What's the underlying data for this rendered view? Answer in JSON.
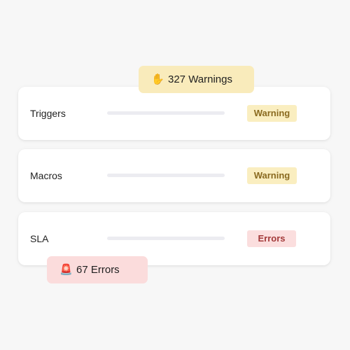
{
  "colors": {
    "warning_bg": "#faeec0",
    "warning_text": "#8a6a1f",
    "error_bg": "#fbdede",
    "error_text": "#a33a3a",
    "warning_pill_bg": "#f9ebbb",
    "error_pill_bg": "#fbdcdc"
  },
  "summary": {
    "warnings": {
      "icon": "raised-hand-icon",
      "glyph": "✋",
      "text": "327 Warnings"
    },
    "errors": {
      "icon": "rotating-light-icon",
      "glyph": "🚨",
      "text": "67 Errors"
    }
  },
  "rows": [
    {
      "label": "Triggers",
      "status": "Warning",
      "status_type": "warning",
      "progress": 0
    },
    {
      "label": "Macros",
      "status": "Warning",
      "status_type": "warning",
      "progress": 0
    },
    {
      "label": "SLA",
      "status": "Errors",
      "status_type": "error",
      "progress": 0
    }
  ]
}
